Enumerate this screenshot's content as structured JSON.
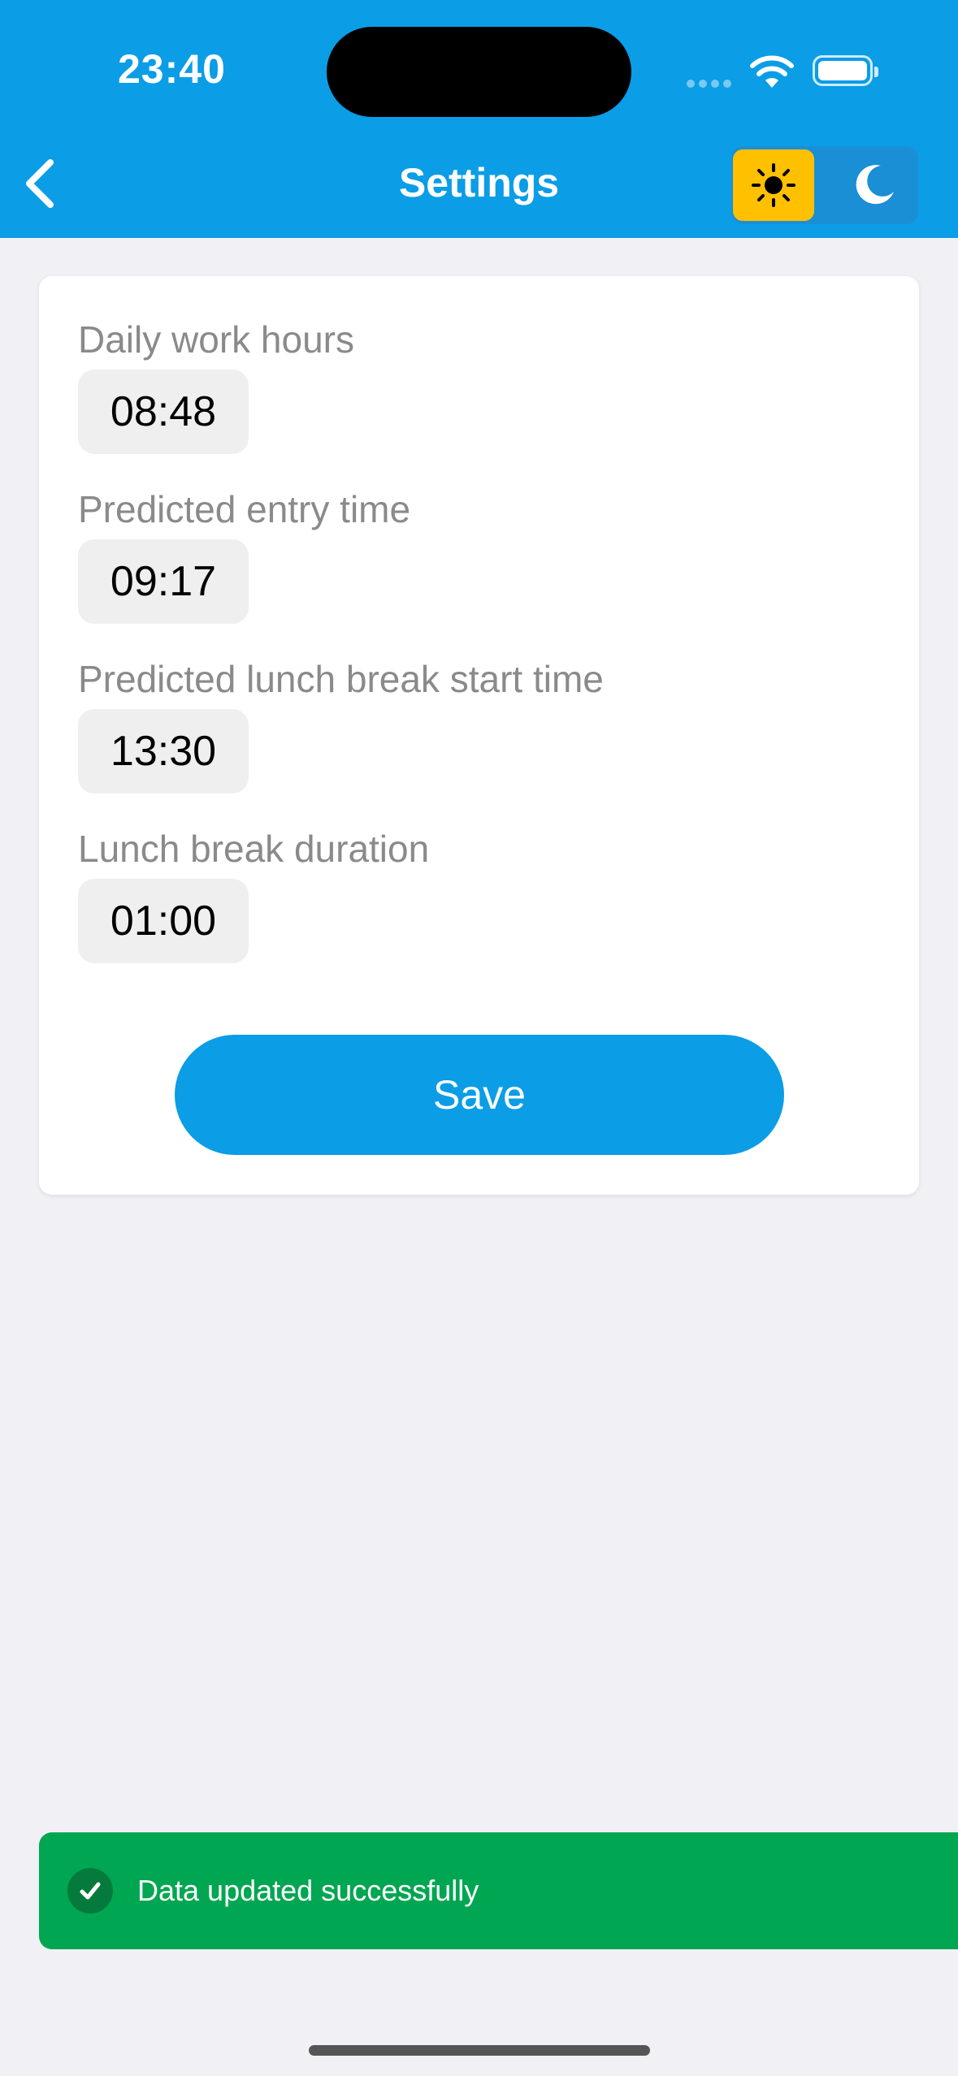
{
  "status_bar": {
    "time": "23:40"
  },
  "header": {
    "title": "Settings",
    "theme_options": [
      "light",
      "dark"
    ],
    "selected_theme": "light"
  },
  "form": {
    "fields": [
      {
        "label": "Daily work hours",
        "value": "08:48"
      },
      {
        "label": "Predicted entry time",
        "value": "09:17"
      },
      {
        "label": "Predicted lunch break start time",
        "value": "13:30"
      },
      {
        "label": "Lunch break duration",
        "value": "01:00"
      }
    ],
    "save_label": "Save"
  },
  "toast": {
    "message": "Data updated successfully",
    "status": "success",
    "color": "#00a651"
  },
  "colors": {
    "accent": "#0b9de6",
    "theme_light_active": "#ffc000"
  }
}
